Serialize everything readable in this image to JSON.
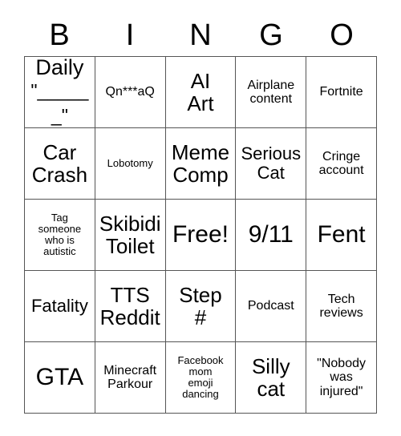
{
  "card": {
    "header_letters": [
      "B",
      "I",
      "N",
      "G",
      "O"
    ],
    "rows": [
      [
        {
          "line1": "Daily",
          "line2": "\"______\"",
          "size": "daily"
        },
        {
          "text": "Qn***aQ",
          "size": "sm"
        },
        {
          "text": "AI\nArt",
          "size": "lg"
        },
        {
          "text": "Airplane\ncontent",
          "size": "sm"
        },
        {
          "text": "Fortnite",
          "size": "sm"
        }
      ],
      [
        {
          "text": "Car\nCrash",
          "size": "lg"
        },
        {
          "text": "Lobotomy",
          "size": "xs"
        },
        {
          "text": "Meme\nComp",
          "size": "lg"
        },
        {
          "text": "Serious\nCat",
          "size": "md"
        },
        {
          "text": "Cringe\naccount",
          "size": "sm"
        }
      ],
      [
        {
          "text": "Tag\nsomeone\nwho is\nautistic",
          "size": "xs"
        },
        {
          "text": "Skibidi\nToilet",
          "size": "lg"
        },
        {
          "text": "Free!",
          "size": "xl"
        },
        {
          "text": "9/11",
          "size": "xl"
        },
        {
          "text": "Fent",
          "size": "xl"
        }
      ],
      [
        {
          "text": "Fatality",
          "size": "md"
        },
        {
          "text": "TTS\nReddit",
          "size": "lg"
        },
        {
          "text": "Step\n#",
          "size": "lg"
        },
        {
          "text": "Podcast",
          "size": "sm"
        },
        {
          "text": "Tech\nreviews",
          "size": "sm"
        }
      ],
      [
        {
          "text": "GTA",
          "size": "xl"
        },
        {
          "text": "Minecraft\nParkour",
          "size": "sm"
        },
        {
          "text": "Facebook\nmom\nemoji\ndancing",
          "size": "xs"
        },
        {
          "text": "Silly\ncat",
          "size": "lg"
        },
        {
          "text": "\"Nobody\nwas\ninjured\"",
          "size": "sm"
        }
      ]
    ]
  },
  "colors": {
    "background": "#ffffff",
    "text": "#000000",
    "grid_line": "#555555"
  }
}
